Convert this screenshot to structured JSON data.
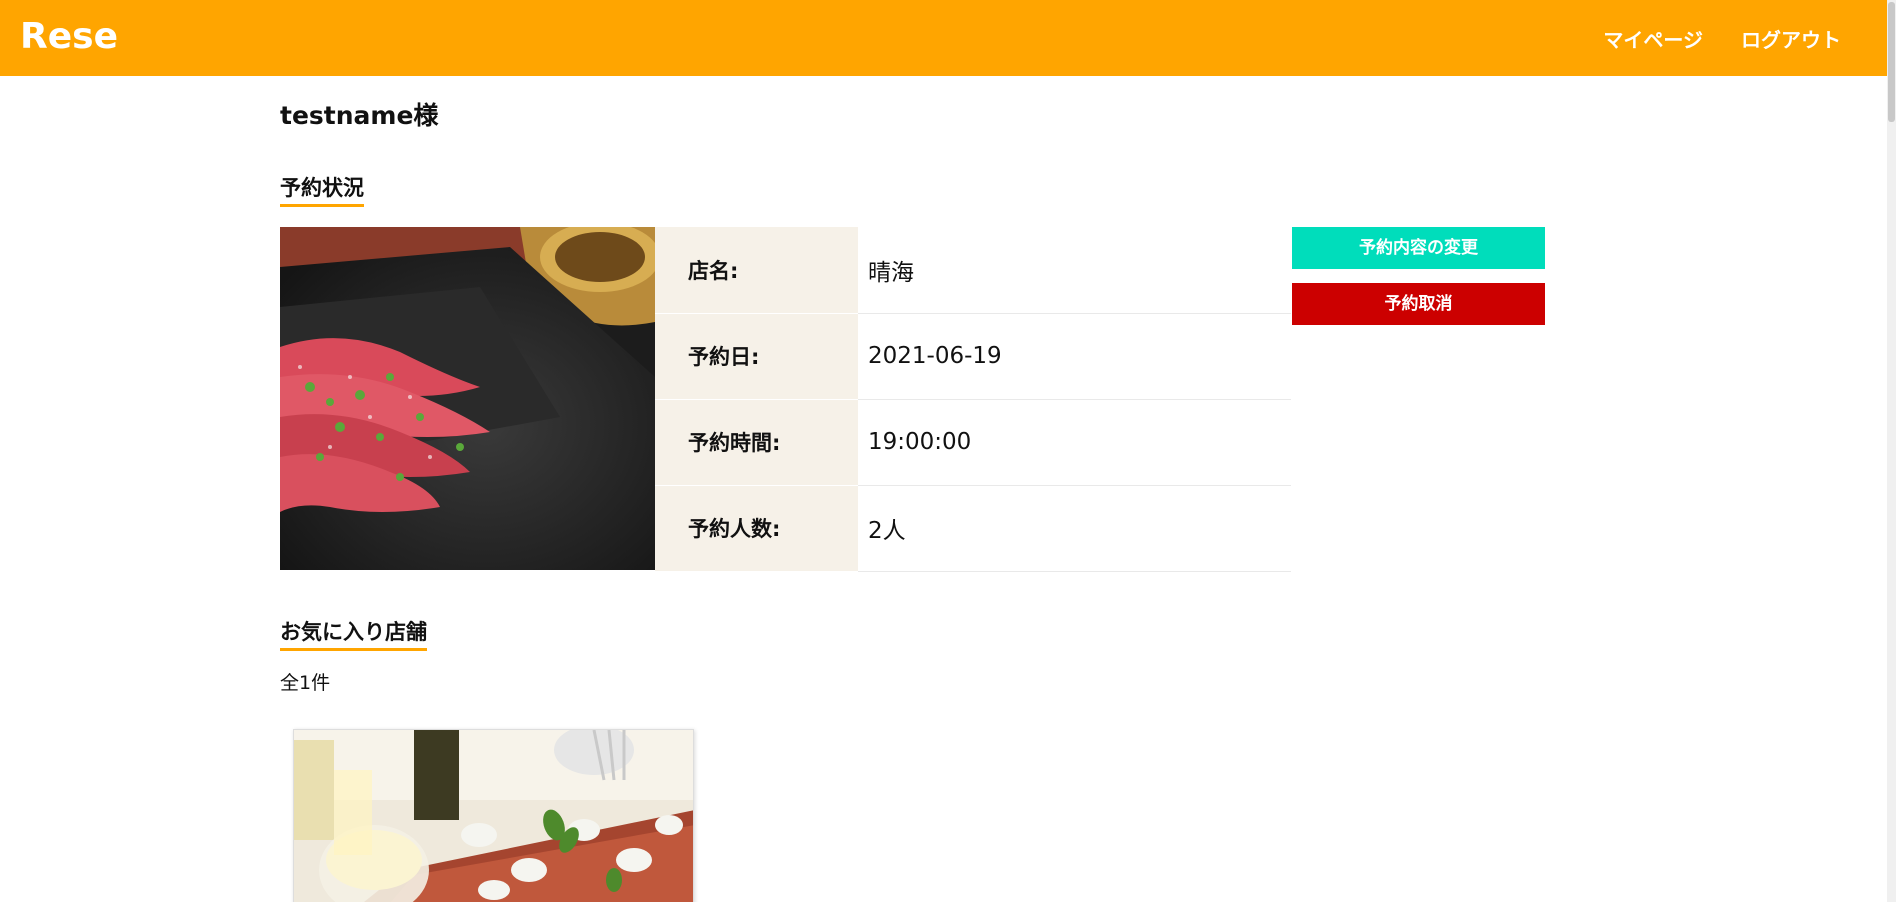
{
  "header": {
    "logo": "Rese",
    "nav": {
      "mypage": "マイページ",
      "logout": "ログアウト"
    },
    "color": "#FFA500"
  },
  "user": {
    "greeting": "testname様"
  },
  "reservation": {
    "section_title": "予約状況",
    "rows": [
      {
        "label": "店名:",
        "value": "晴海"
      },
      {
        "label": "予約日:",
        "value": "2021-06-19"
      },
      {
        "label": "予約時間:",
        "value": "19:00:00"
      },
      {
        "label": "予約人数:",
        "value": "2人"
      }
    ],
    "buttons": {
      "change": "予約内容の変更",
      "cancel": "予約取消"
    },
    "colors": {
      "change": "#00DDBB",
      "cancel": "#CC0000",
      "label_bg": "#F6F1E8"
    }
  },
  "favorites": {
    "section_title": "お気に入り店舗",
    "count": "全1件"
  }
}
